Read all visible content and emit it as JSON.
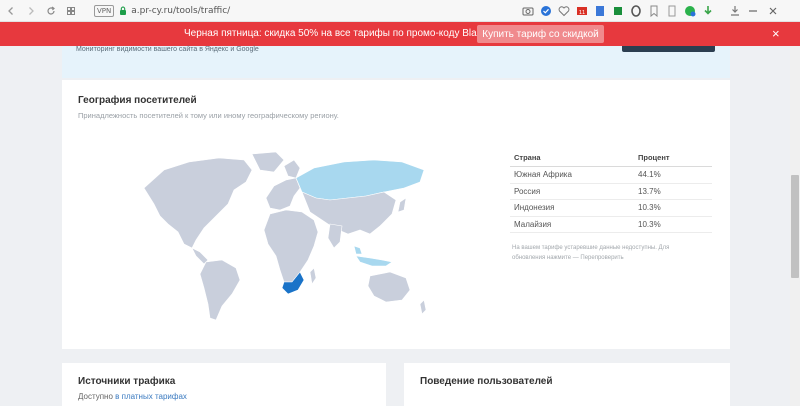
{
  "browser": {
    "url": "a.pr-cy.ru/tools/traffic/",
    "vpn_label": "VPN",
    "back_icon": "arrow-left-icon",
    "forward_icon": "arrow-right-icon",
    "reload_icon": "reload-icon",
    "grid_icon": "grid-icon",
    "minimize_icon": "minimize-icon",
    "close_icon": "close-icon"
  },
  "promo": {
    "text": "Черная пятница: скидка 50% на все тарифы по промо-коду BlackFriday11",
    "button_label": "Купить тариф со скидкой",
    "close_label": "×",
    "background": "#e7393e"
  },
  "top_card": {
    "text": "Мониторинг видимости вашего сайта в Яндекс и Google"
  },
  "geography": {
    "title": "География посетителей",
    "subtitle": "Принадлежность посетителей к тому или иному географическому региону.",
    "table": {
      "headers": [
        "Страна",
        "Процент"
      ],
      "rows": [
        {
          "country": "Южная Африка",
          "percent": "44.1%"
        },
        {
          "country": "Россия",
          "percent": "13.7%"
        },
        {
          "country": "Индонезия",
          "percent": "10.3%"
        },
        {
          "country": "Малайзия",
          "percent": "10.3%"
        }
      ]
    },
    "note_line1": "На вашем тарифе устаревшие данные недоступны. Для",
    "note_line2": "обновления нажмите — Перепроверить",
    "map_colors": {
      "base": "#c9cfdc",
      "highlight": "#a8d8ef",
      "primary": "#1a73c8"
    }
  },
  "traffic_sources": {
    "title": "Источники трафика",
    "sub_prefix": "Доступно ",
    "sub_link": "в платных тарифах"
  },
  "user_behavior": {
    "title": "Поведение пользователей"
  }
}
